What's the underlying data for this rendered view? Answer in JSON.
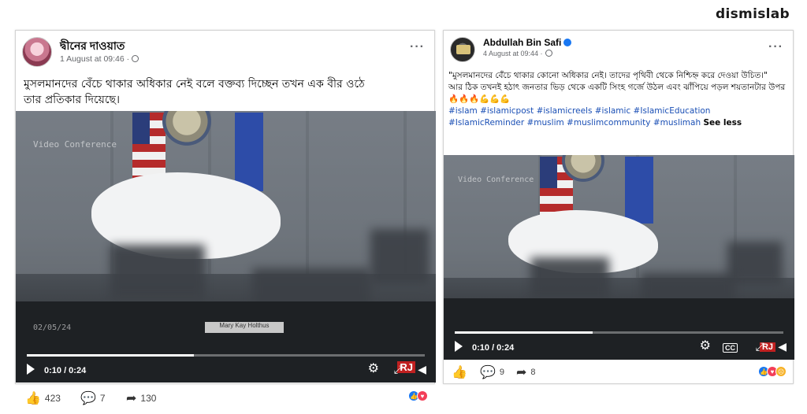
{
  "brand": "dismislab",
  "post1": {
    "author": "দ্বীনের দাওয়াত",
    "timestamp": "1 August at 09:46 ·",
    "text_line1": "মুসলমানদের বেঁচে থাকার অধিকার নেই বলে বক্তব্য দিচ্ছেন তখন এক বীর ওঠে",
    "text_line2": "তার প্রতিকার দিয়েছে।",
    "video": {
      "watermark": "Video Conference",
      "overlay_time": "02/05/24",
      "time": "0:10 / 0:24",
      "nameplate": "Mary Kay Holthus",
      "logo": "RJ"
    },
    "likes": "423",
    "comments": "7",
    "shares": "130"
  },
  "post2": {
    "author": "Abdullah Bin Safi",
    "timestamp": "4 August at 09:44 ·",
    "text_p1": "\"মুসলমানদের বেঁচে থাকার কোনো অধিকার নেই। তাদের পৃথিবী থেকে নিশ্চিহ্ন করে দেওয়া উচিত।\"",
    "text_p2": "আর ঠিক তখনই হঠাৎ জনতার ভিড় থেকে একটি সিংহ গর্জে উঠল এবং ঝাঁপিয়ে পড়ল শয়তানটার উপর🔥🔥🔥💪💪💪",
    "hashtags": "#islam #islamicpost #islamicreels #islamic #IslamicEducation #IslamicReminder #muslim #muslimcommunity #muslimah",
    "see_less": "See less",
    "video": {
      "watermark": "Video Conference",
      "time": "0:10 / 0:24",
      "cc": "CC",
      "logo": "RJ"
    },
    "comments": "9",
    "shares": "8"
  },
  "colors": {
    "link_blue": "#1a4fb5",
    "facebook_blue": "#1877f2",
    "love_red": "#f33e58"
  }
}
